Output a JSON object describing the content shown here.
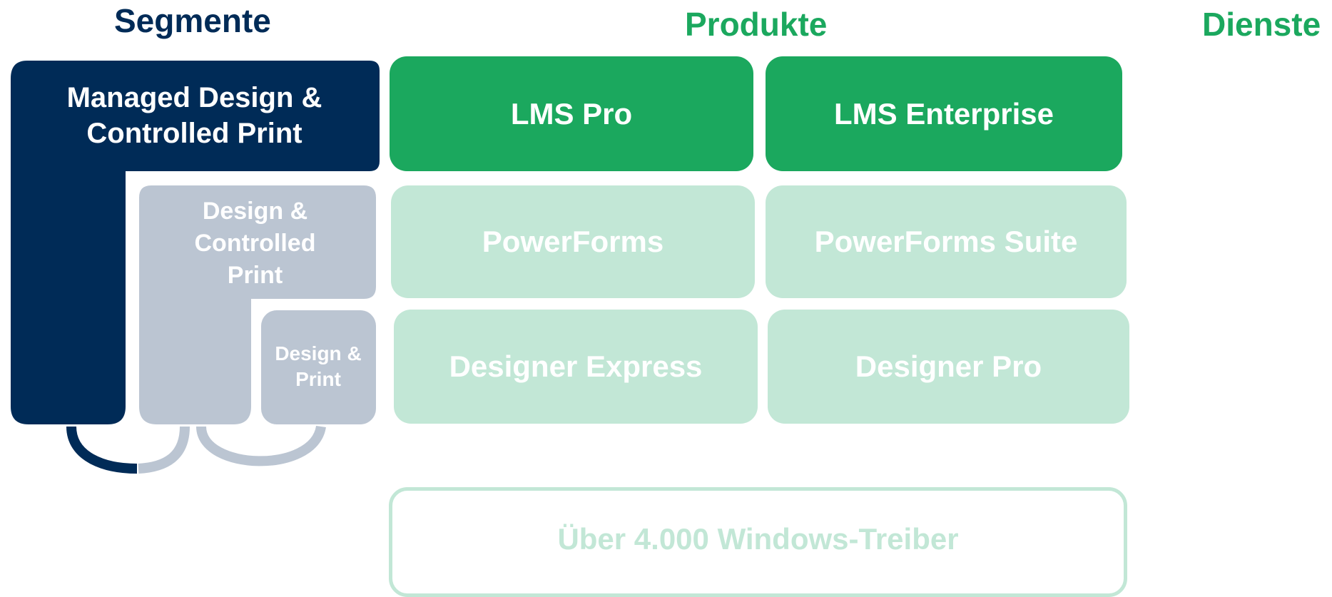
{
  "headings": {
    "segments": "Segmente",
    "products": "Produkte",
    "services": "Dienste"
  },
  "segments": [
    {
      "label": "Managed Design & Controlled Print"
    },
    {
      "label": "Design & Controlled Print"
    },
    {
      "label": "Design & Print"
    }
  ],
  "products": [
    {
      "label": "LMS Pro"
    },
    {
      "label": "LMS Enterprise"
    },
    {
      "label": "PowerForms"
    },
    {
      "label": "PowerForms Suite"
    },
    {
      "label": "Designer Express"
    },
    {
      "label": "Designer Pro"
    }
  ],
  "drivers": {
    "label": "Über 4.000 Windows-Treiber"
  },
  "colors": {
    "navy": "#002B57",
    "green": "#1BA85E",
    "light_green": "#C2E7D6",
    "grey": "#BBC5D2",
    "white": "#FFFFFF"
  }
}
